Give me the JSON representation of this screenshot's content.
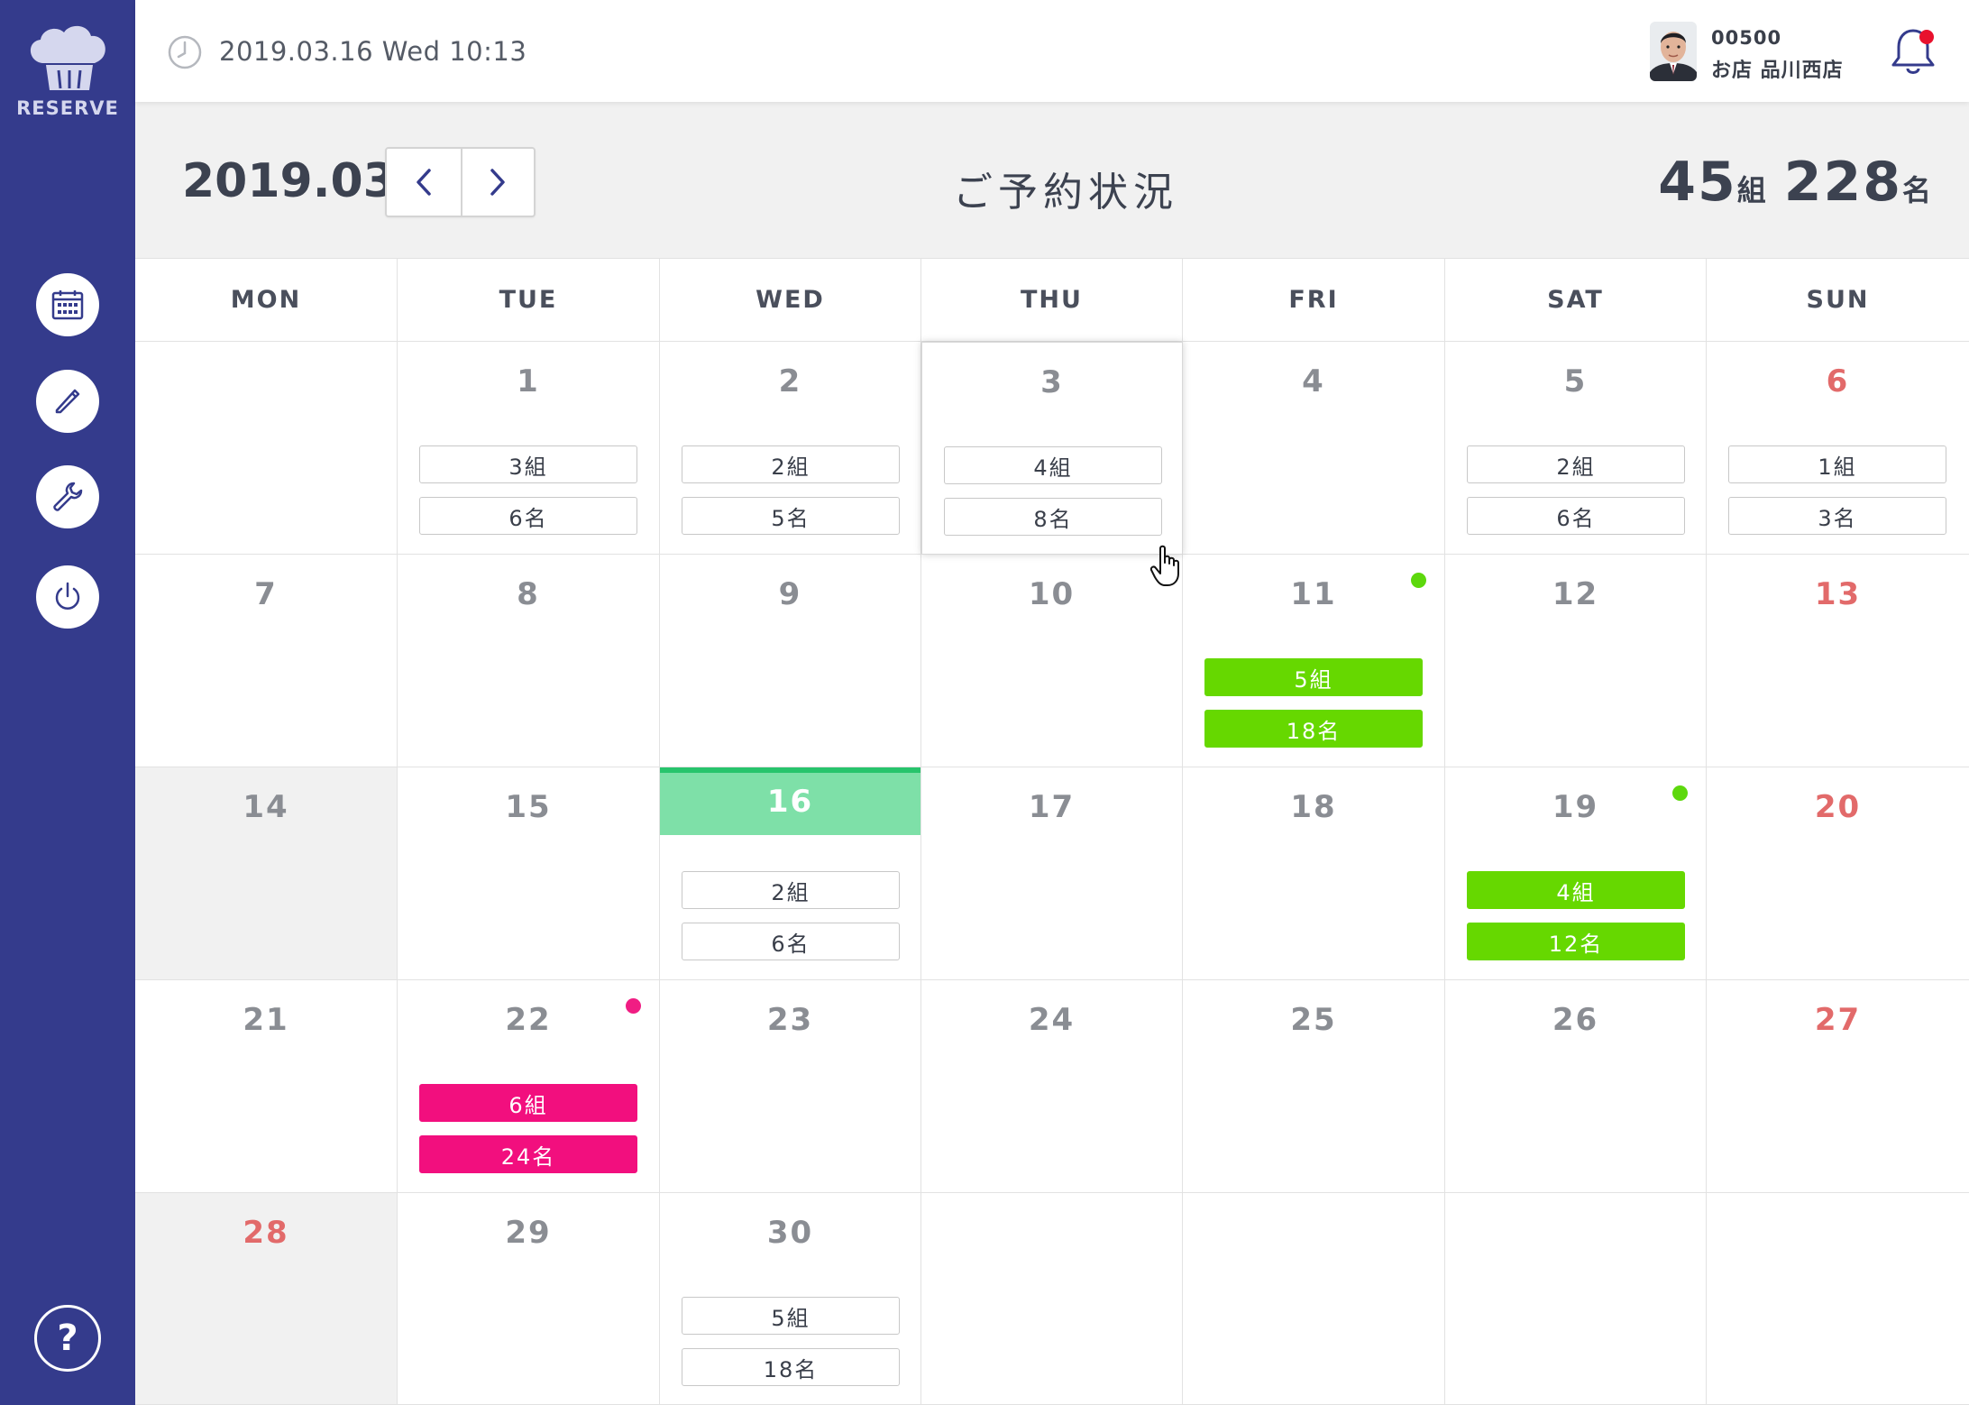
{
  "app": {
    "logo_text": "RESERVE"
  },
  "topbar": {
    "datetime": "2019.03.16 Wed  10:13",
    "user_id": "00500",
    "store_name": "お店 品川西店"
  },
  "header": {
    "month": "2019.03",
    "title": "ご予約状況",
    "totals": {
      "groups": "45",
      "groups_unit": "組",
      "people": "228",
      "people_unit": "名"
    }
  },
  "calendar": {
    "weekdays": [
      "MON",
      "TUE",
      "WED",
      "THU",
      "FRI",
      "SAT",
      "SUN"
    ],
    "cells": [
      {
        "day": ""
      },
      {
        "day": "1",
        "groups": "3組",
        "people": "6名"
      },
      {
        "day": "2",
        "groups": "2組",
        "people": "5名"
      },
      {
        "day": "3",
        "groups": "4組",
        "people": "8名",
        "selected": true
      },
      {
        "day": "4"
      },
      {
        "day": "5",
        "groups": "2組",
        "people": "6名"
      },
      {
        "day": "6",
        "groups": "1組",
        "people": "3名",
        "sunday": true
      },
      {
        "day": "7"
      },
      {
        "day": "8"
      },
      {
        "day": "9"
      },
      {
        "day": "10"
      },
      {
        "day": "11",
        "groups": "5組",
        "people": "18名",
        "style": "green",
        "dot": "green"
      },
      {
        "day": "12"
      },
      {
        "day": "13",
        "sunday": true
      },
      {
        "day": "14",
        "gray": true
      },
      {
        "day": "15"
      },
      {
        "day": "16",
        "groups": "2組",
        "people": "6名",
        "today": true
      },
      {
        "day": "17"
      },
      {
        "day": "18"
      },
      {
        "day": "19",
        "groups": "4組",
        "people": "12名",
        "style": "green",
        "dot": "green"
      },
      {
        "day": "20",
        "sunday": true
      },
      {
        "day": "21"
      },
      {
        "day": "22",
        "groups": "6組",
        "people": "24名",
        "style": "pink",
        "dot": "pink"
      },
      {
        "day": "23"
      },
      {
        "day": "24"
      },
      {
        "day": "25"
      },
      {
        "day": "26"
      },
      {
        "day": "27",
        "sunday": true
      },
      {
        "day": "28",
        "gray": true,
        "sunday": true
      },
      {
        "day": "29"
      },
      {
        "day": "30",
        "groups": "5組",
        "people": "18名"
      },
      {
        "day": ""
      },
      {
        "day": ""
      },
      {
        "day": ""
      },
      {
        "day": ""
      }
    ]
  },
  "colors": {
    "sidebar": "#343b8c",
    "today": "#7ee0a8",
    "green": "#66d800",
    "pink": "#f20f7e",
    "sunday": "#e26a6a"
  },
  "icons": {
    "logo": "chef-hat-icon",
    "clock": "clock-icon",
    "bell": "bell-icon",
    "sidebar": [
      "calendar-icon",
      "pencil-icon",
      "wrench-icon",
      "power-icon"
    ],
    "help": "question-icon"
  }
}
